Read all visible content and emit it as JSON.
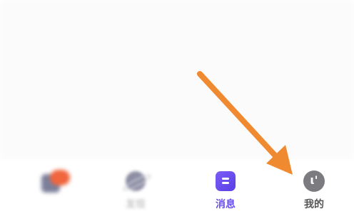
{
  "tabbar": {
    "tabs": [
      {
        "label": "",
        "icon": "home-icon",
        "state": "blurred"
      },
      {
        "label": "发现",
        "icon": "planet-icon",
        "state": "blurred"
      },
      {
        "label": "消息",
        "icon": "message-icon",
        "state": "active"
      },
      {
        "label": "我的",
        "icon": "profile-icon",
        "state": "normal"
      }
    ],
    "me_glyph": "ι'"
  },
  "annotation": {
    "type": "arrow",
    "target": "tab-me",
    "color": "#f08a30"
  },
  "colors": {
    "active": "#6a4ef0",
    "arrow": "#f08a30",
    "me_icon": "#7b7b80"
  }
}
